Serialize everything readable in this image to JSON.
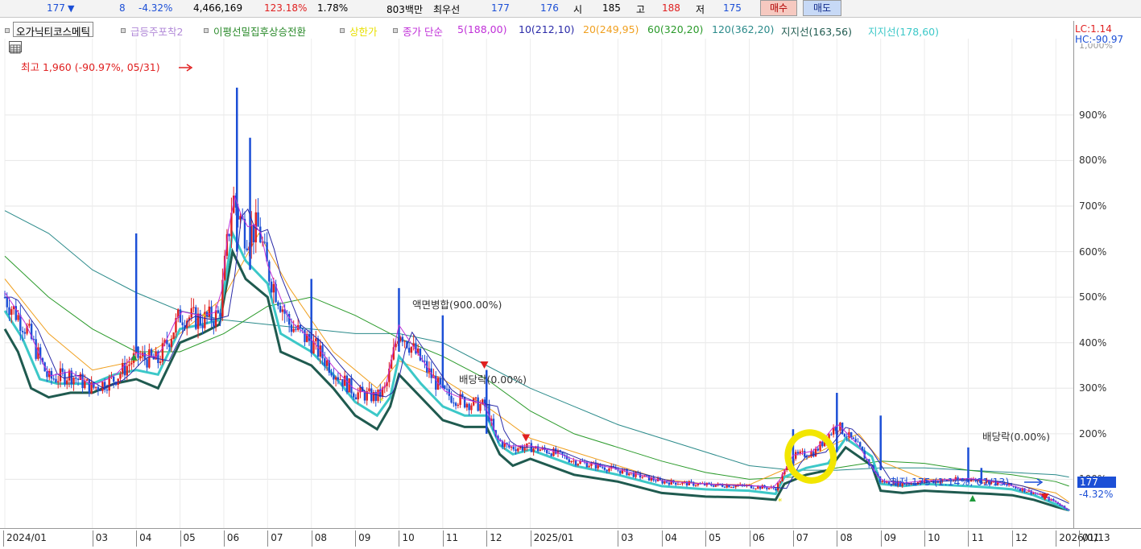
{
  "quote_bar": {
    "price": "177",
    "change_arrow": "▼",
    "change": "8",
    "change_pct": "-4.32%",
    "volume": "4,466,169",
    "volume_ratio": "123.18%",
    "turnover": "1.78%",
    "amount": "803백만",
    "best_label": "최우선",
    "best_ask": "177",
    "best_bid": "176",
    "open_label": "시",
    "open": "185",
    "high_label": "고",
    "high": "188",
    "low_label": "저",
    "low": "175",
    "buy_button": "매수",
    "sell_button": "매도"
  },
  "legend": {
    "stock_name": "오가닉티코스메틱",
    "ind1": "급등주포착2",
    "ind2": "이평선밀집후상승전환",
    "ind3": "상한가",
    "ma_prefix": "종가 단순",
    "ma5": "5(188,00)",
    "ma10": "10(212,10)",
    "ma20": "20(249,95)",
    "ma60": "60(320,20)",
    "ma120": "120(362,20)",
    "support1": "지지선(163,56)",
    "support2": "지지선(178,60)"
  },
  "colors": {
    "up": "#e02020",
    "down": "#1c4fd6",
    "ma5": "#c030d8",
    "ma10": "#2a2aa8",
    "ma20": "#f0a020",
    "ma60": "#2a9a2a",
    "ma120": "#2a8a8a",
    "support1": "#1f5a4f",
    "support2": "#3cc8c8",
    "highlight": "#f2e600"
  },
  "chart_data": {
    "type": "candlestick",
    "y_scale": "percent of base",
    "ylim": [
      0,
      1050
    ],
    "y_ticks": [
      "900%",
      "800%",
      "700%",
      "600%",
      "500%",
      "400%",
      "300%",
      "200%",
      "100%"
    ],
    "y_tick_values": [
      900,
      800,
      700,
      600,
      500,
      400,
      300,
      200,
      100
    ],
    "x_ticks": [
      "2024/01",
      "03",
      "04",
      "05",
      "06",
      "07",
      "08",
      "09",
      "10",
      "11",
      "12",
      "2025/01",
      "03",
      "04",
      "05",
      "06",
      "07",
      "08",
      "09",
      "10",
      "11",
      "12",
      "2026/01",
      "01/13"
    ],
    "x_tick_months": [
      0,
      2,
      3,
      4,
      5,
      6,
      7,
      8,
      9,
      10,
      11,
      12,
      14,
      15,
      16,
      17,
      18,
      19,
      20,
      21,
      22,
      23,
      24,
      24.4
    ],
    "close_path": [
      [
        0.0,
        500
      ],
      [
        0.5,
        430
      ],
      [
        1.0,
        320
      ],
      [
        1.5,
        330
      ],
      [
        2.0,
        300
      ],
      [
        2.5,
        320
      ],
      [
        3.0,
        370
      ],
      [
        3.5,
        360
      ],
      [
        4.0,
        460
      ],
      [
        4.5,
        450
      ],
      [
        4.9,
        460
      ],
      [
        5.2,
        720
      ],
      [
        5.5,
        640
      ],
      [
        5.8,
        650
      ],
      [
        6.0,
        560
      ],
      [
        6.5,
        440
      ],
      [
        7.0,
        400
      ],
      [
        7.5,
        340
      ],
      [
        8.0,
        290
      ],
      [
        8.5,
        280
      ],
      [
        8.7,
        300
      ],
      [
        9.0,
        430
      ],
      [
        9.5,
        360
      ],
      [
        10.0,
        290
      ],
      [
        10.5,
        270
      ],
      [
        11.0,
        260
      ],
      [
        11.2,
        190
      ],
      [
        11.5,
        170
      ],
      [
        12.0,
        170
      ],
      [
        12.5,
        160
      ],
      [
        13.0,
        140
      ],
      [
        14.0,
        120
      ],
      [
        15.0,
        95
      ],
      [
        16.0,
        88
      ],
      [
        17.0,
        85
      ],
      [
        17.6,
        80
      ],
      [
        18.0,
        150
      ],
      [
        18.5,
        160
      ],
      [
        19.0,
        220
      ],
      [
        19.5,
        170
      ],
      [
        20.0,
        95
      ],
      [
        20.5,
        90
      ],
      [
        21.0,
        95
      ],
      [
        22.0,
        100
      ],
      [
        22.5,
        95
      ],
      [
        23.0,
        85
      ],
      [
        23.5,
        70
      ],
      [
        24.0,
        50
      ],
      [
        24.3,
        32
      ]
    ],
    "support1_path": [
      [
        0.0,
        430
      ],
      [
        0.3,
        380
      ],
      [
        0.6,
        300
      ],
      [
        1.0,
        280
      ],
      [
        1.5,
        290
      ],
      [
        2.0,
        290
      ],
      [
        2.5,
        310
      ],
      [
        3.0,
        320
      ],
      [
        3.5,
        300
      ],
      [
        4.0,
        400
      ],
      [
        4.5,
        420
      ],
      [
        4.9,
        440
      ],
      [
        5.2,
        600
      ],
      [
        5.5,
        540
      ],
      [
        6.0,
        500
      ],
      [
        6.3,
        380
      ],
      [
        7.0,
        350
      ],
      [
        7.5,
        300
      ],
      [
        8.0,
        240
      ],
      [
        8.5,
        210
      ],
      [
        8.8,
        260
      ],
      [
        9.0,
        330
      ],
      [
        9.5,
        280
      ],
      [
        10.0,
        230
      ],
      [
        10.5,
        215
      ],
      [
        11.0,
        215
      ],
      [
        11.3,
        155
      ],
      [
        11.6,
        130
      ],
      [
        12.0,
        145
      ],
      [
        13.0,
        110
      ],
      [
        14.0,
        95
      ],
      [
        15.0,
        70
      ],
      [
        16.0,
        62
      ],
      [
        17.0,
        60
      ],
      [
        17.6,
        55
      ],
      [
        17.8,
        90
      ],
      [
        18.3,
        110
      ],
      [
        18.8,
        120
      ],
      [
        19.2,
        170
      ],
      [
        19.8,
        130
      ],
      [
        20.0,
        75
      ],
      [
        20.5,
        70
      ],
      [
        21.0,
        75
      ],
      [
        22.0,
        70
      ],
      [
        22.5,
        68
      ],
      [
        23.0,
        65
      ],
      [
        23.5,
        55
      ],
      [
        24.0,
        40
      ],
      [
        24.3,
        32
      ]
    ],
    "support2_path": [
      [
        0.0,
        470
      ],
      [
        0.4,
        410
      ],
      [
        0.8,
        320
      ],
      [
        1.2,
        310
      ],
      [
        1.6,
        310
      ],
      [
        2.0,
        310
      ],
      [
        2.5,
        330
      ],
      [
        3.0,
        340
      ],
      [
        3.5,
        330
      ],
      [
        4.0,
        430
      ],
      [
        4.5,
        440
      ],
      [
        4.9,
        450
      ],
      [
        5.2,
        640
      ],
      [
        5.5,
        580
      ],
      [
        6.0,
        530
      ],
      [
        6.3,
        420
      ],
      [
        7.0,
        380
      ],
      [
        7.5,
        330
      ],
      [
        8.0,
        270
      ],
      [
        8.5,
        240
      ],
      [
        8.8,
        280
      ],
      [
        9.0,
        370
      ],
      [
        9.5,
        310
      ],
      [
        10.0,
        260
      ],
      [
        10.5,
        240
      ],
      [
        11.0,
        240
      ],
      [
        11.3,
        175
      ],
      [
        11.6,
        155
      ],
      [
        12.0,
        165
      ],
      [
        13.0,
        130
      ],
      [
        14.0,
        110
      ],
      [
        15.0,
        85
      ],
      [
        16.0,
        78
      ],
      [
        17.0,
        75
      ],
      [
        17.6,
        68
      ],
      [
        17.8,
        105
      ],
      [
        18.3,
        125
      ],
      [
        18.8,
        135
      ],
      [
        19.2,
        190
      ],
      [
        19.8,
        150
      ],
      [
        20.0,
        90
      ],
      [
        20.5,
        85
      ],
      [
        21.0,
        90
      ],
      [
        22.0,
        85
      ],
      [
        22.5,
        82
      ],
      [
        23.0,
        78
      ],
      [
        23.5,
        65
      ],
      [
        24.0,
        45
      ],
      [
        24.3,
        32
      ]
    ],
    "ma20_path": [
      [
        0.0,
        540
      ],
      [
        1.0,
        420
      ],
      [
        2.0,
        340
      ],
      [
        3.0,
        360
      ],
      [
        4.0,
        420
      ],
      [
        5.0,
        500
      ],
      [
        5.8,
        640
      ],
      [
        6.5,
        520
      ],
      [
        7.5,
        380
      ],
      [
        8.5,
        300
      ],
      [
        9.0,
        360
      ],
      [
        10.0,
        320
      ],
      [
        11.0,
        260
      ],
      [
        12.0,
        190
      ],
      [
        13.0,
        160
      ],
      [
        14.0,
        130
      ],
      [
        15.0,
        100
      ],
      [
        16.0,
        90
      ],
      [
        17.0,
        88
      ],
      [
        18.0,
        130
      ],
      [
        19.0,
        180
      ],
      [
        19.5,
        200
      ],
      [
        20.0,
        140
      ],
      [
        21.0,
        100
      ],
      [
        22.0,
        100
      ],
      [
        23.0,
        90
      ],
      [
        24.0,
        70
      ],
      [
        24.3,
        50
      ]
    ],
    "ma60_path": [
      [
        0.0,
        590
      ],
      [
        1.0,
        500
      ],
      [
        2.0,
        430
      ],
      [
        3.0,
        380
      ],
      [
        4.0,
        380
      ],
      [
        5.0,
        420
      ],
      [
        6.0,
        480
      ],
      [
        7.0,
        500
      ],
      [
        8.0,
        460
      ],
      [
        9.0,
        410
      ],
      [
        10.0,
        370
      ],
      [
        11.0,
        320
      ],
      [
        12.0,
        250
      ],
      [
        13.0,
        200
      ],
      [
        14.0,
        170
      ],
      [
        15.0,
        140
      ],
      [
        16.0,
        115
      ],
      [
        17.0,
        100
      ],
      [
        18.0,
        105
      ],
      [
        19.0,
        125
      ],
      [
        20.0,
        140
      ],
      [
        21.0,
        135
      ],
      [
        22.0,
        120
      ],
      [
        23.0,
        110
      ],
      [
        24.0,
        95
      ],
      [
        24.3,
        85
      ]
    ],
    "ma120_path": [
      [
        0.0,
        690
      ],
      [
        1.0,
        640
      ],
      [
        2.0,
        560
      ],
      [
        3.0,
        510
      ],
      [
        4.0,
        470
      ],
      [
        5.0,
        450
      ],
      [
        6.0,
        440
      ],
      [
        7.0,
        430
      ],
      [
        8.0,
        420
      ],
      [
        9.0,
        420
      ],
      [
        10.0,
        400
      ],
      [
        11.0,
        350
      ],
      [
        12.0,
        300
      ],
      [
        13.0,
        260
      ],
      [
        14.0,
        220
      ],
      [
        15.0,
        190
      ],
      [
        16.0,
        160
      ],
      [
        17.0,
        130
      ],
      [
        18.0,
        120
      ],
      [
        19.0,
        120
      ],
      [
        20.0,
        125
      ],
      [
        21.0,
        125
      ],
      [
        22.0,
        120
      ],
      [
        23.0,
        115
      ],
      [
        24.0,
        110
      ],
      [
        24.3,
        105
      ]
    ],
    "spikes": [
      [
        3.0,
        640,
        380
      ],
      [
        5.3,
        960,
        600
      ],
      [
        5.6,
        850,
        560
      ],
      [
        7.0,
        540,
        380
      ],
      [
        9.0,
        520,
        380
      ],
      [
        10.0,
        460,
        300
      ],
      [
        11.0,
        340,
        200
      ],
      [
        18.0,
        210,
        110
      ],
      [
        19.0,
        290,
        160
      ],
      [
        20.0,
        240,
        120
      ],
      [
        22.0,
        170,
        95
      ],
      [
        22.3,
        125,
        90
      ]
    ],
    "annotations": {
      "high": "최고 1,960 (-90.97%, 05/31)",
      "low": "최저 175 (1.14%, 01/13)",
      "merge": "액면병합(900.00%)",
      "div1": "배당락(0.00%)",
      "div2": "배당락(0.00%)",
      "lc": "LC:1.14",
      "hc": "HC:-90.97",
      "last_price": "177",
      "last_change": "-4.32%",
      "top_tick_partial": "1,000%"
    }
  }
}
